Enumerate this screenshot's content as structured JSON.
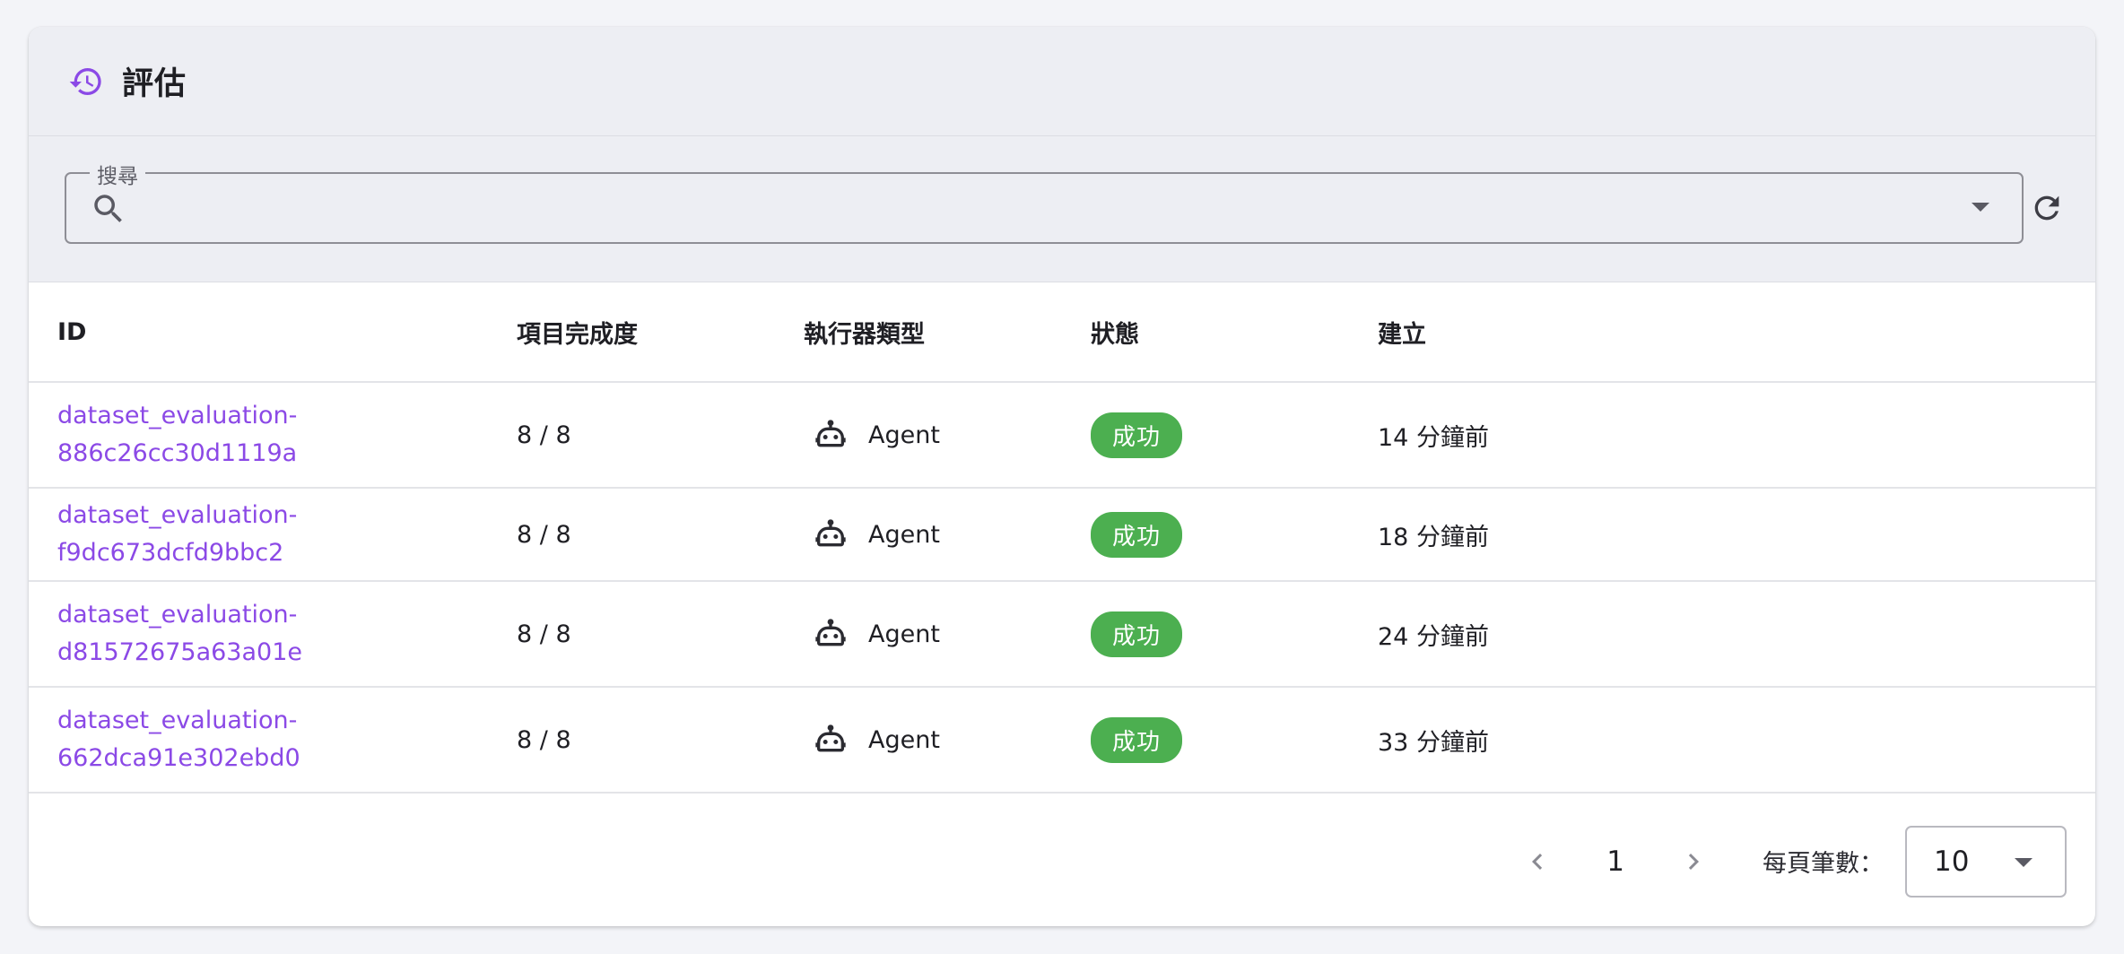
{
  "header": {
    "title": "評估",
    "icon": "history-icon",
    "accent": "#8b49e6"
  },
  "search": {
    "legend": "搜尋",
    "value": "",
    "placeholder": ""
  },
  "table": {
    "columns": [
      "ID",
      "項目完成度",
      "執行器類型",
      "狀態",
      "建立"
    ],
    "rows": [
      {
        "id_line1": "dataset_evaluation-",
        "id_line2": "886c26cc30d1119a",
        "progress": "8 / 8",
        "executor": "Agent",
        "status": "成功",
        "created": "14 分鐘前"
      },
      {
        "id_line1": "dataset_evaluation-f9dc673dcfd9bbc2",
        "id_line2": "",
        "progress": "8 / 8",
        "executor": "Agent",
        "status": "成功",
        "created": "18 分鐘前"
      },
      {
        "id_line1": "dataset_evaluation-",
        "id_line2": "d81572675a63a01e",
        "progress": "8 / 8",
        "executor": "Agent",
        "status": "成功",
        "created": "24 分鐘前"
      },
      {
        "id_line1": "dataset_evaluation-",
        "id_line2": "662dca91e302ebd0",
        "progress": "8 / 8",
        "executor": "Agent",
        "status": "成功",
        "created": "33 分鐘前"
      }
    ]
  },
  "pagination": {
    "current_page": "1",
    "per_page_label": "每頁筆數：",
    "per_page_value": "10"
  },
  "colors": {
    "link": "#8b49e6",
    "success": "#4caf50",
    "header_bg": "#edeef3"
  }
}
